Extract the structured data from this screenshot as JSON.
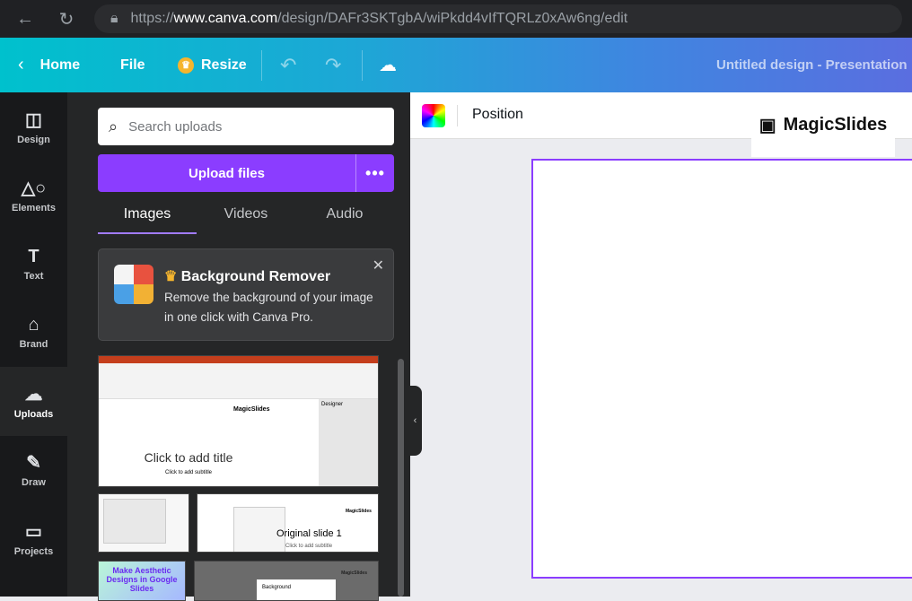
{
  "browser": {
    "url_prefix": "https://",
    "url_host": "www.canva.com",
    "url_path": "/design/DAFr3SKTgbA/wiPkdd4vIfTQRLz0xAw6ng/edit"
  },
  "topbar": {
    "home": "Home",
    "file": "File",
    "resize": "Resize",
    "title": "Untitled design - Presentation"
  },
  "rail": [
    {
      "label": "Design"
    },
    {
      "label": "Elements"
    },
    {
      "label": "Text"
    },
    {
      "label": "Brand"
    },
    {
      "label": "Uploads"
    },
    {
      "label": "Draw"
    },
    {
      "label": "Projects"
    }
  ],
  "panel": {
    "search_placeholder": "Search uploads",
    "upload_label": "Upload files",
    "more": "•••",
    "tabs": [
      "Images",
      "Videos",
      "Audio"
    ],
    "promo": {
      "title": "Background Remover",
      "desc": "Remove the background of your image in one click with Canva Pro."
    },
    "thumbs": {
      "t1_title": "Click to add title",
      "t1_sub": "Click to add subtitle",
      "t1_logo": "MagicSlides",
      "t1_designer": "Designer",
      "t3_title": "Original slide 1",
      "t3_sub": "Click to add subtitle",
      "t3_logo": "MagicSlides",
      "t4": "Make Aesthetic Designs in Google Slides",
      "t5_logo": "MagicSlides",
      "t5_dialog": "Background"
    }
  },
  "canvas": {
    "position": "Position",
    "logo": "MagicSlides"
  }
}
